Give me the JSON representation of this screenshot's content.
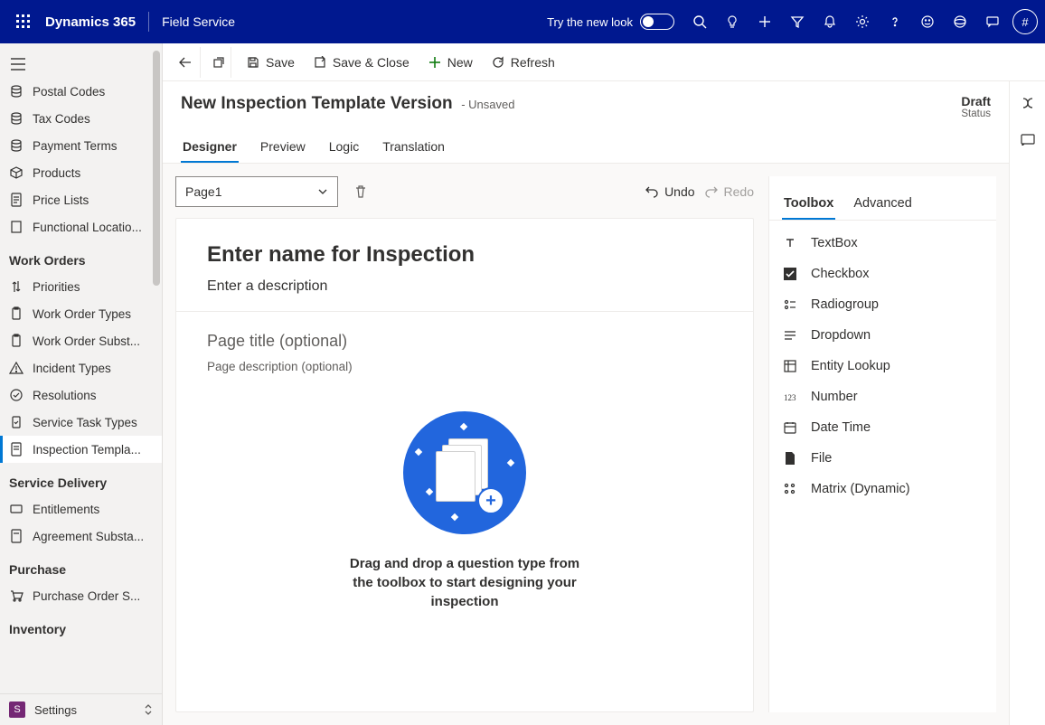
{
  "topbar": {
    "brand": "Dynamics 365",
    "app": "Field Service",
    "try_label": "Try the new look",
    "avatar_initial": "#"
  },
  "sidebar": {
    "items": [
      {
        "icon": "postal",
        "label": "Postal Codes"
      },
      {
        "icon": "tax",
        "label": "Tax Codes"
      },
      {
        "icon": "payment",
        "label": "Payment Terms"
      },
      {
        "icon": "products",
        "label": "Products"
      },
      {
        "icon": "pricelist",
        "label": "Price Lists"
      },
      {
        "icon": "location",
        "label": "Functional Locatio..."
      }
    ],
    "groups": [
      {
        "label": "Work Orders",
        "items": [
          {
            "icon": "priorities",
            "label": "Priorities"
          },
          {
            "icon": "wotypes",
            "label": "Work Order Types"
          },
          {
            "icon": "wosubst",
            "label": "Work Order Subst..."
          },
          {
            "icon": "incident",
            "label": "Incident Types"
          },
          {
            "icon": "resolutions",
            "label": "Resolutions"
          },
          {
            "icon": "servicetask",
            "label": "Service Task Types"
          },
          {
            "icon": "inspection",
            "label": "Inspection Templa...",
            "active": true
          }
        ]
      },
      {
        "label": "Service Delivery",
        "items": [
          {
            "icon": "entitlements",
            "label": "Entitlements"
          },
          {
            "icon": "agreement",
            "label": "Agreement Substa..."
          }
        ]
      },
      {
        "label": "Purchase",
        "items": [
          {
            "icon": "po",
            "label": "Purchase Order S..."
          }
        ]
      },
      {
        "label": "Inventory",
        "items": []
      }
    ],
    "footer": {
      "letter": "S",
      "label": "Settings"
    }
  },
  "cmdbar": {
    "save": "Save",
    "save_close": "Save & Close",
    "new": "New",
    "refresh": "Refresh"
  },
  "header": {
    "title": "New Inspection Template Version",
    "subtitle": "- Unsaved",
    "status_value": "Draft",
    "status_label": "Status"
  },
  "tabs": [
    "Designer",
    "Preview",
    "Logic",
    "Translation"
  ],
  "designer": {
    "page_selector": "Page1",
    "undo": "Undo",
    "redo": "Redo",
    "canvas_title_placeholder": "Enter name for Inspection",
    "canvas_desc_placeholder": "Enter a description",
    "page_title_placeholder": "Page title (optional)",
    "page_desc_placeholder": "Page description (optional)",
    "empty_msg": "Drag and drop a question type from the toolbox to start designing your inspection"
  },
  "toolbox": {
    "tabs": [
      "Toolbox",
      "Advanced"
    ],
    "items": [
      {
        "icon": "text",
        "label": "TextBox"
      },
      {
        "icon": "checkbox",
        "label": "Checkbox"
      },
      {
        "icon": "radio",
        "label": "Radiogroup"
      },
      {
        "icon": "dropdown",
        "label": "Dropdown"
      },
      {
        "icon": "lookup",
        "label": "Entity Lookup"
      },
      {
        "icon": "number",
        "label": "Number"
      },
      {
        "icon": "datetime",
        "label": "Date Time"
      },
      {
        "icon": "file",
        "label": "File"
      },
      {
        "icon": "matrix",
        "label": "Matrix (Dynamic)"
      }
    ]
  }
}
